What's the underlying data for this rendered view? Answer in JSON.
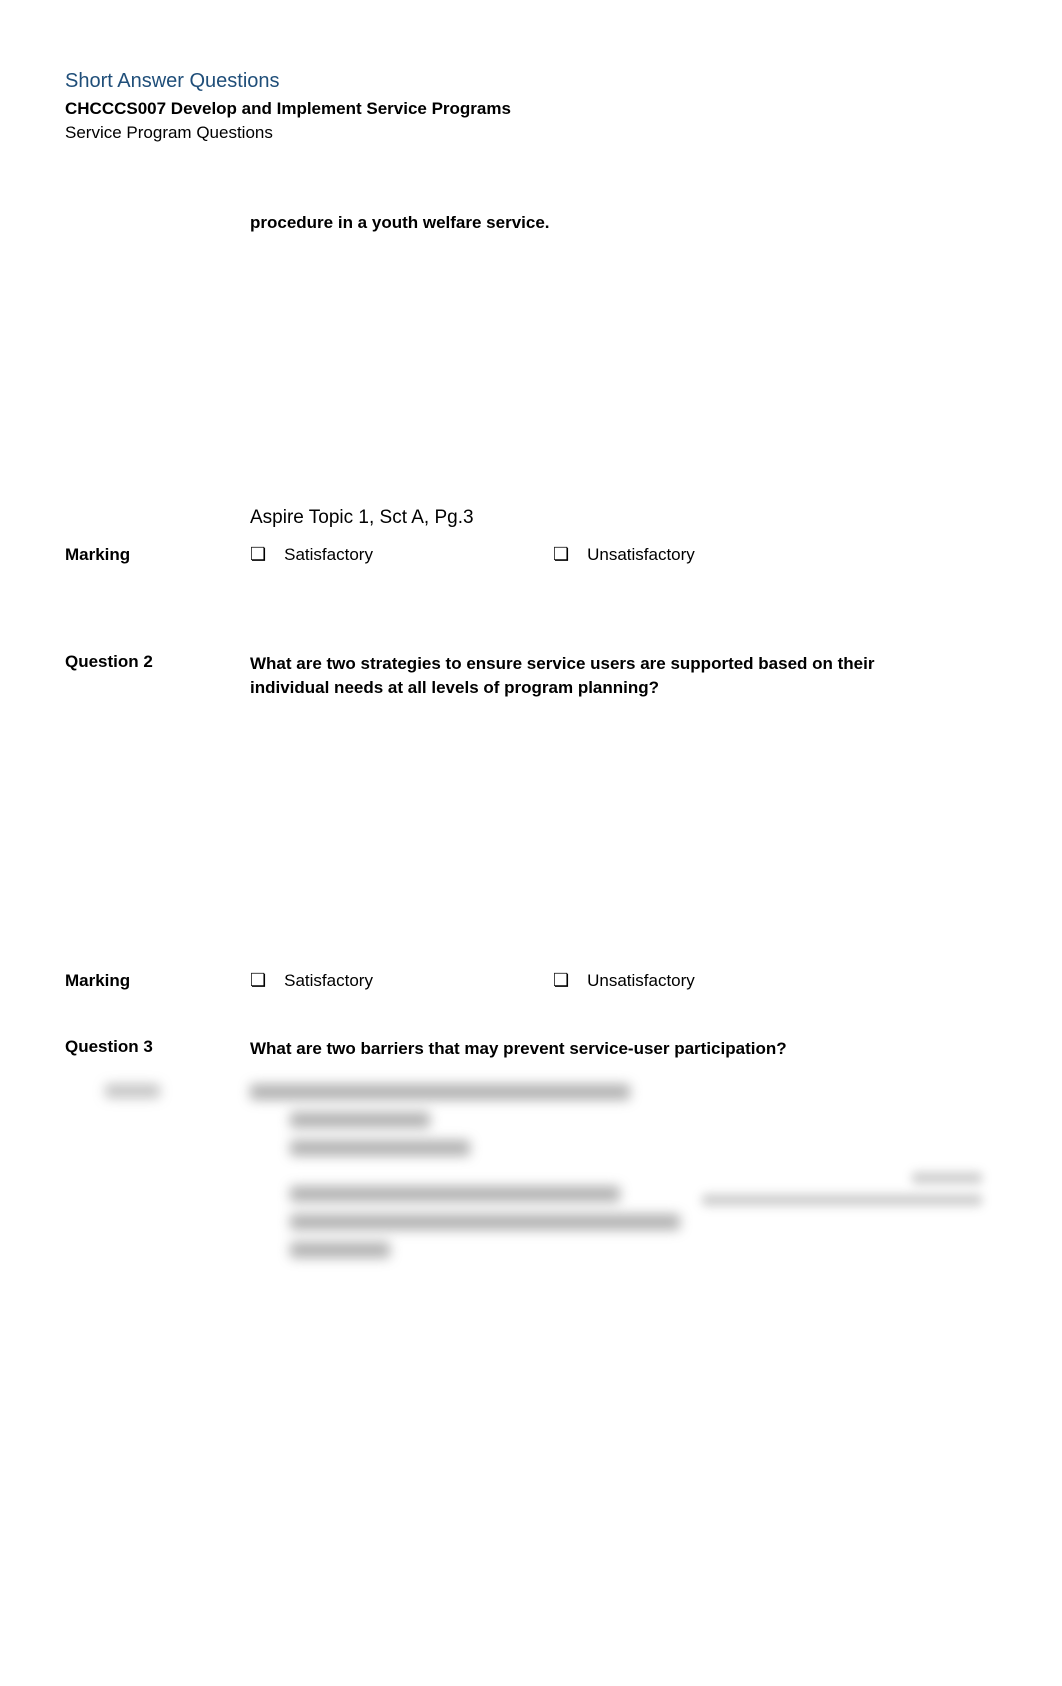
{
  "header": {
    "title": "Short Answer Questions",
    "unit_code": "CHCCCS007 Develop and Implement Service Programs",
    "subtitle": "Service Program Questions"
  },
  "question1": {
    "partial_text": "procedure in a youth welfare service.",
    "reference": "Aspire Topic 1, Sct A, Pg.3"
  },
  "marking": {
    "label": "Marking",
    "satisfactory": "Satisfactory",
    "unsatisfactory": "Unsatisfactory"
  },
  "question2": {
    "label": "Question 2",
    "text": "What are two strategies to ensure service users are supported based on their individual needs at all levels of program planning?"
  },
  "question3": {
    "label": "Question 3",
    "text": "What are two barriers that may prevent service-user participation?"
  }
}
